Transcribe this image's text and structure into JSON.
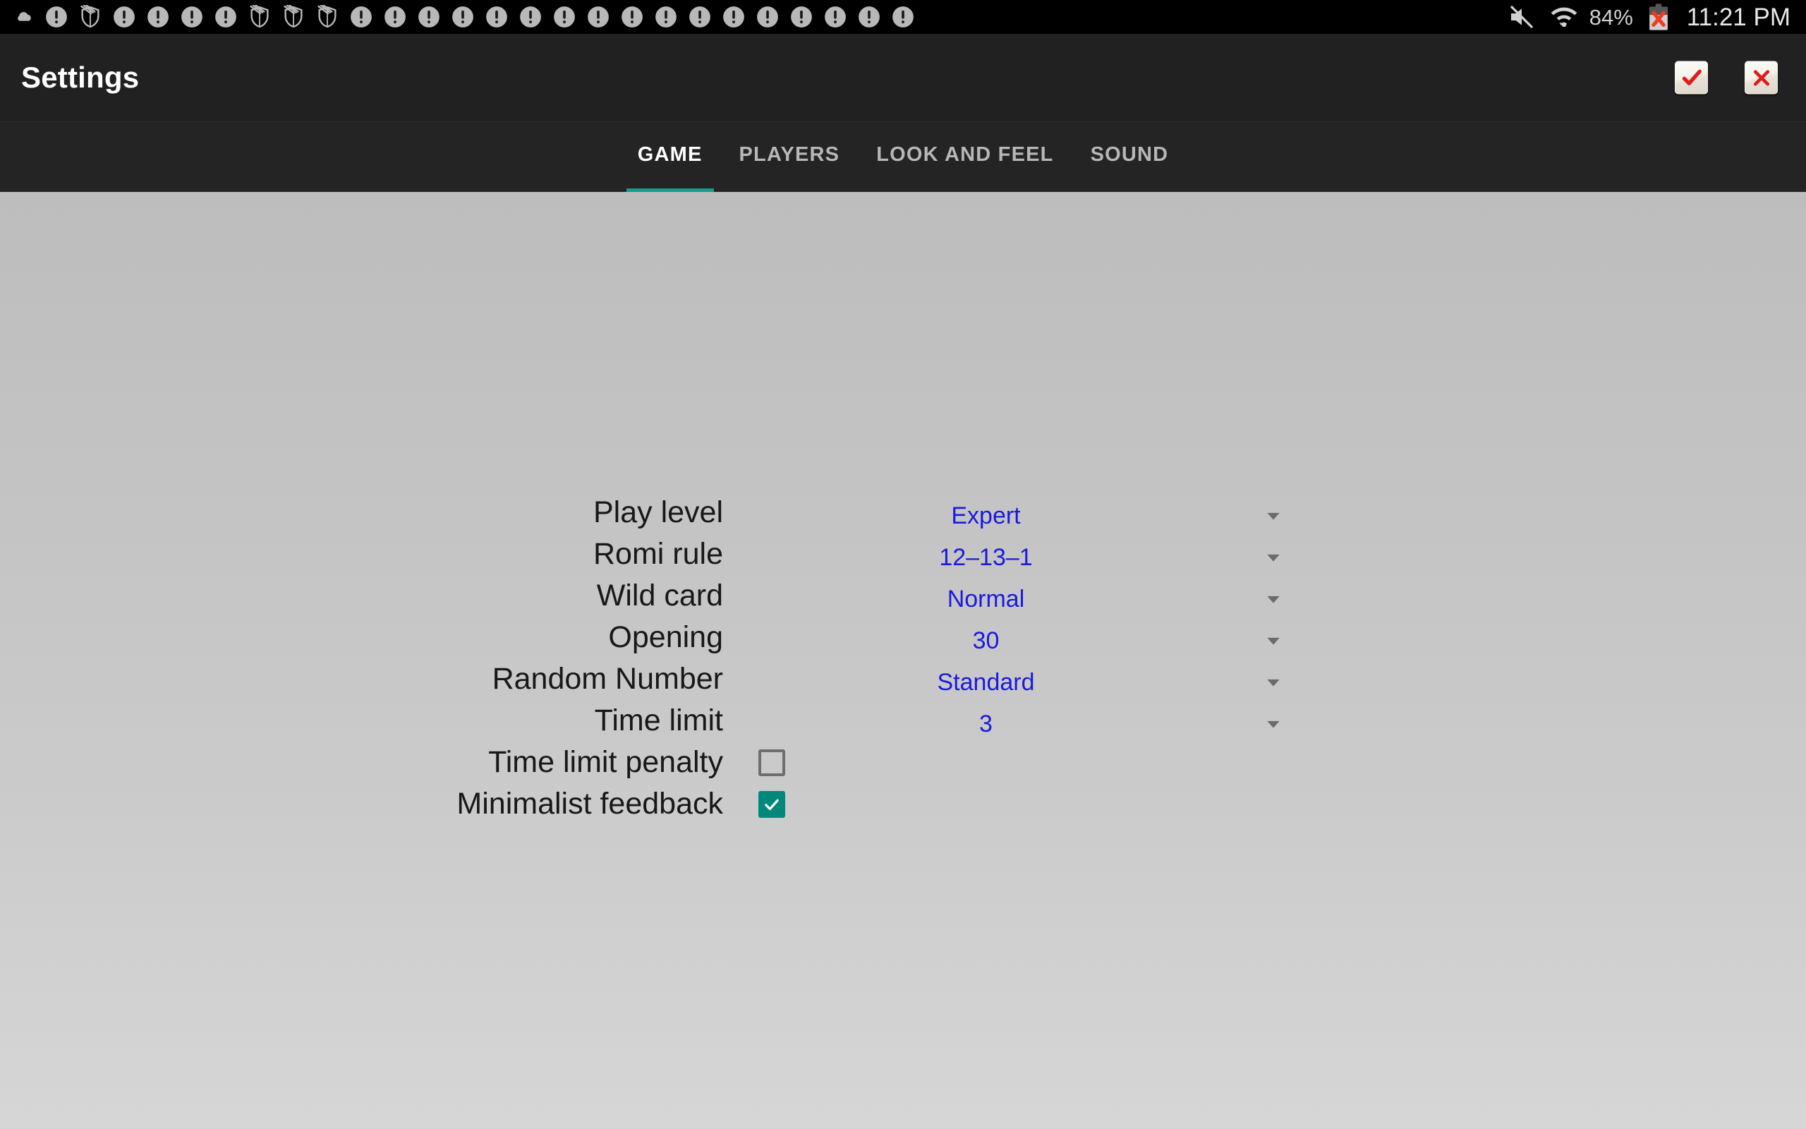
{
  "status_bar": {
    "icons": [
      {
        "name": "cloud-icon"
      },
      {
        "name": "alert-circle-icon"
      },
      {
        "name": "shield-off-icon"
      },
      {
        "name": "alert-circle-icon"
      },
      {
        "name": "alert-circle-icon"
      },
      {
        "name": "alert-circle-icon"
      },
      {
        "name": "alert-circle-icon"
      },
      {
        "name": "shield-off-icon"
      },
      {
        "name": "shield-off-icon"
      },
      {
        "name": "shield-off-icon"
      },
      {
        "name": "alert-circle-icon"
      },
      {
        "name": "alert-circle-icon"
      },
      {
        "name": "alert-circle-icon"
      },
      {
        "name": "alert-circle-icon"
      },
      {
        "name": "alert-circle-icon"
      },
      {
        "name": "alert-circle-icon"
      },
      {
        "name": "alert-circle-icon"
      },
      {
        "name": "alert-circle-icon"
      },
      {
        "name": "alert-circle-icon"
      },
      {
        "name": "alert-circle-icon"
      },
      {
        "name": "alert-circle-icon"
      },
      {
        "name": "alert-circle-icon"
      },
      {
        "name": "alert-circle-icon"
      },
      {
        "name": "alert-circle-icon"
      },
      {
        "name": "alert-circle-icon"
      },
      {
        "name": "alert-circle-icon"
      },
      {
        "name": "alert-circle-icon"
      }
    ],
    "mute_icon": "volume-muted-icon",
    "wifi_icon": "wifi-icon",
    "battery_percent": "84%",
    "battery_icon": "battery-error-icon",
    "clock": "11:21 PM"
  },
  "header": {
    "title": "Settings",
    "confirm_label": "confirm",
    "cancel_label": "cancel",
    "confirm_icon": "check-icon",
    "cancel_icon": "x-icon"
  },
  "tabs": [
    {
      "label": "GAME",
      "active": true
    },
    {
      "label": "PLAYERS",
      "active": false
    },
    {
      "label": "LOOK AND FEEL",
      "active": false
    },
    {
      "label": "SOUND",
      "active": false
    }
  ],
  "settings": {
    "dropdown_rows": [
      {
        "label": "Play level",
        "value": "Expert",
        "caret_icon": "chevron-down-icon"
      },
      {
        "label": "Romi rule",
        "value": "12‒13‒1",
        "caret_icon": "chevron-down-icon"
      },
      {
        "label": "Wild card",
        "value": "Normal",
        "caret_icon": "chevron-down-icon"
      },
      {
        "label": "Opening",
        "value": "30",
        "caret_icon": "chevron-down-icon"
      },
      {
        "label": "Random Number",
        "value": "Standard",
        "caret_icon": "chevron-down-icon"
      },
      {
        "label": "Time limit",
        "value": "3",
        "caret_icon": "chevron-down-icon"
      }
    ],
    "checkbox_rows": [
      {
        "label": "Time limit penalty",
        "checked": false
      },
      {
        "label": "Minimalist feedback",
        "checked": true
      }
    ]
  },
  "colors": {
    "accent_teal": "#159b88",
    "checkbox_teal": "#00897b",
    "value_blue": "#1a1ae0",
    "header_bg": "#212121",
    "statusbar_bg": "#000000",
    "action_red": "#e01b1b"
  }
}
